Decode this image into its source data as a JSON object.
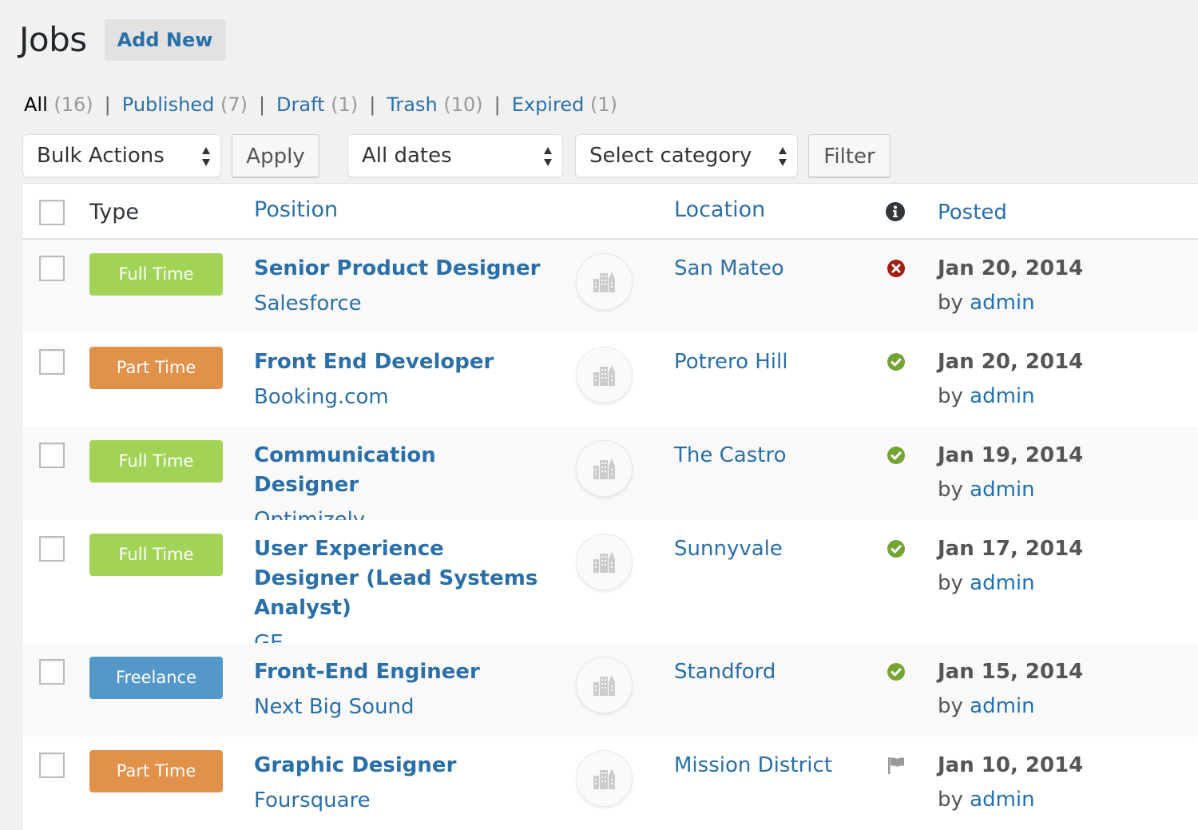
{
  "header": {
    "title": "Jobs",
    "add_new_label": "Add New"
  },
  "views": [
    {
      "label": "All",
      "count": "(16)",
      "current": true
    },
    {
      "label": "Published",
      "count": "(7)",
      "current": false
    },
    {
      "label": "Draft",
      "count": "(1)",
      "current": false
    },
    {
      "label": "Trash",
      "count": "(10)",
      "current": false
    },
    {
      "label": "Expired",
      "count": "(1)",
      "current": false
    }
  ],
  "toolbar": {
    "bulk_actions": "Bulk Actions",
    "apply_label": "Apply",
    "dates": "All dates",
    "category": "Select category",
    "filter_label": "Filter"
  },
  "columns": {
    "type": "Type",
    "position": "Position",
    "location": "Location",
    "status_icon": "info-icon",
    "posted": "Posted"
  },
  "colors": {
    "full_time": "#a1d456",
    "part_time": "#e2914a",
    "freelance": "#5398c9",
    "link": "#2a6fa8",
    "status_expired": "#a51c14",
    "status_active": "#74a434",
    "status_flag": "#999999"
  },
  "jobs": [
    {
      "type": "Full Time",
      "type_key": "full_time",
      "title": "Senior Product Designer",
      "company": "Salesforce",
      "location": "San Mateo",
      "status": "expired",
      "date": "Jan 20, 2014",
      "by_prefix": "by",
      "author": "admin"
    },
    {
      "type": "Part Time",
      "type_key": "part_time",
      "title": "Front End Developer",
      "company": "Booking.com",
      "location": "Potrero Hill",
      "status": "active",
      "date": "Jan 20, 2014",
      "by_prefix": "by",
      "author": "admin"
    },
    {
      "type": "Full Time",
      "type_key": "full_time",
      "title": "Communication Designer",
      "company": "Optimizely",
      "location": "The Castro",
      "status": "active",
      "date": "Jan 19, 2014",
      "by_prefix": "by",
      "author": "admin"
    },
    {
      "type": "Full Time",
      "type_key": "full_time",
      "title": "User Experience Designer (Lead Systems Analyst)",
      "company": "GE",
      "location": "Sunnyvale",
      "status": "active",
      "date": "Jan 17, 2014",
      "by_prefix": "by",
      "author": "admin"
    },
    {
      "type": "Freelance",
      "type_key": "freelance",
      "title": "Front-End Engineer",
      "company": "Next Big Sound",
      "location": "Standford",
      "status": "active",
      "date": "Jan 15, 2014",
      "by_prefix": "by",
      "author": "admin"
    },
    {
      "type": "Part Time",
      "type_key": "part_time",
      "title": "Graphic Designer",
      "company": "Foursquare",
      "location": "Mission District",
      "status": "flagged",
      "date": "Jan 10, 2014",
      "by_prefix": "by",
      "author": "admin"
    }
  ]
}
